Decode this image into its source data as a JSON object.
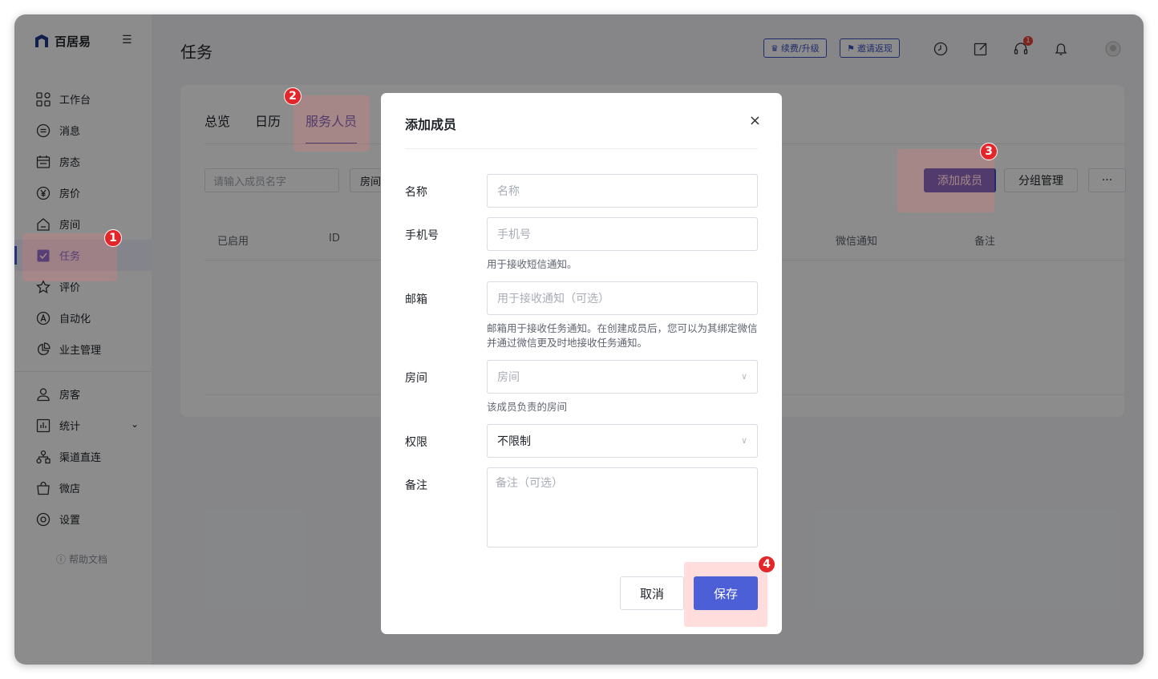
{
  "app": {
    "brand": "百居易",
    "page_title": "任务"
  },
  "sidebar": {
    "items": [
      {
        "label": "工作台",
        "icon": "grid-icon"
      },
      {
        "label": "消息",
        "icon": "message-icon"
      },
      {
        "label": "房态",
        "icon": "calendar-icon"
      },
      {
        "label": "房价",
        "icon": "yuan-icon"
      },
      {
        "label": "房间",
        "icon": "home-icon"
      },
      {
        "label": "任务",
        "icon": "checkbox-icon"
      },
      {
        "label": "评价",
        "icon": "star-icon"
      },
      {
        "label": "自动化",
        "icon": "auto-icon"
      },
      {
        "label": "业主管理",
        "icon": "pie-icon"
      },
      {
        "label": "房客",
        "icon": "user-icon"
      },
      {
        "label": "统计",
        "icon": "chart-icon"
      },
      {
        "label": "渠道直连",
        "icon": "network-icon"
      },
      {
        "label": "微店",
        "icon": "shop-icon"
      },
      {
        "label": "设置",
        "icon": "gear-icon"
      }
    ],
    "active": "任务",
    "help": "帮助文档"
  },
  "topbar": {
    "renew_label": "续费/升级",
    "invite_label": "邀请返现",
    "support_badge": "1"
  },
  "tabs": [
    "总览",
    "日历",
    "服务人员"
  ],
  "filters": {
    "search_placeholder": "请输入成员名字",
    "room_label": "房间"
  },
  "actions": {
    "add_member": "添加成员",
    "group_manage": "分组管理",
    "more": "···"
  },
  "table": {
    "headers": [
      "已启用",
      "ID",
      "微信通知",
      "备注"
    ]
  },
  "modal": {
    "title": "添加成员",
    "close": "×",
    "fields": {
      "name": {
        "label": "名称",
        "placeholder": "名称"
      },
      "phone": {
        "label": "手机号",
        "placeholder": "手机号",
        "help": "用于接收短信通知。"
      },
      "email": {
        "label": "邮箱",
        "placeholder": "用于接收通知（可选）",
        "help": "邮箱用于接收任务通知。在创建成员后，您可以为其绑定微信并通过微信更及时地接收任务通知。"
      },
      "room": {
        "label": "房间",
        "placeholder": "房间",
        "help": "该成员负责的房间"
      },
      "permission": {
        "label": "权限",
        "value": "不限制"
      },
      "note": {
        "label": "备注",
        "placeholder": "备注（可选）"
      }
    },
    "cancel": "取消",
    "save": "保存"
  },
  "markers": [
    "1",
    "2",
    "3",
    "4"
  ],
  "colors": {
    "accent": "#3d4fc2",
    "marker": "#e4262a"
  }
}
